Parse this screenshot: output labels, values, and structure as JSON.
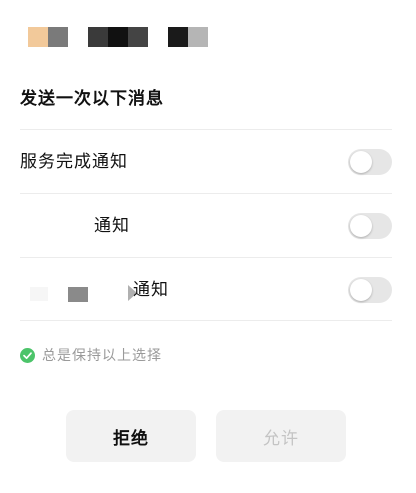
{
  "header": {
    "app_name_redacted": true
  },
  "dialog": {
    "title": "发送一次以下消息",
    "options": [
      {
        "label": "服务完成通知",
        "enabled": false
      },
      {
        "label": "通知",
        "enabled": false,
        "name_partially_redacted": true
      },
      {
        "label": "通知",
        "enabled": false,
        "name_partially_redacted": true
      }
    ],
    "remember": {
      "label": "总是保持以上选择",
      "checked": true,
      "icon": "check-circle-icon"
    },
    "buttons": {
      "reject_label": "拒绝",
      "allow_label": "允许",
      "allow_disabled": true
    }
  },
  "colors": {
    "toggle_off": "#e6e6e6",
    "check_green": "#4cc46a",
    "muted_text": "#9a9a9a",
    "button_bg": "#f2f2f2",
    "disabled_text": "#c4c4c4",
    "divider": "#ececec"
  }
}
